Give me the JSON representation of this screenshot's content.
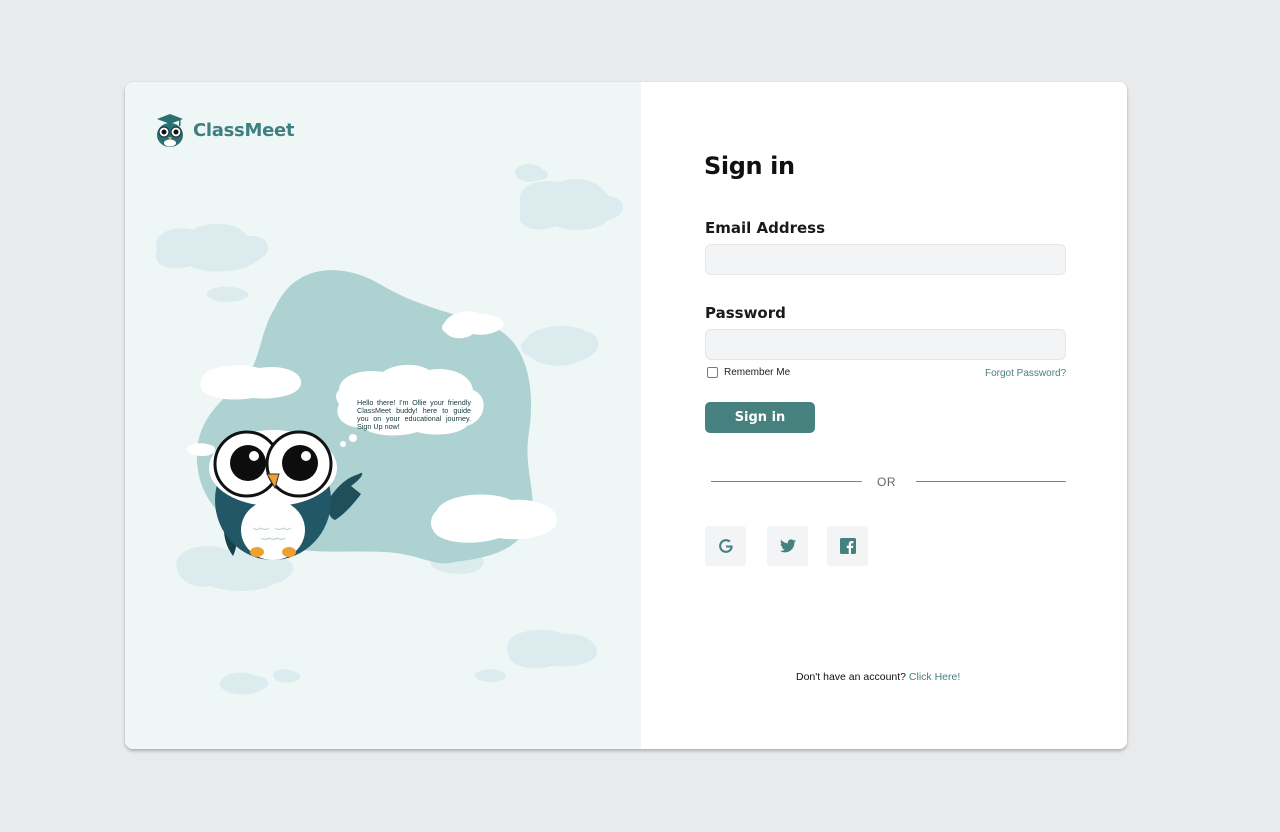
{
  "brand": {
    "name": "ClassMeet"
  },
  "mascot": {
    "speech": "Hello there! I'm Ollie your friendly ClassMeet buddy! here to guide you on your educational journey. Sign Up now!"
  },
  "signin": {
    "title": "Sign in",
    "email_label": "Email Address",
    "email_value": "",
    "password_label": "Password",
    "password_value": "",
    "remember_label": "Remember Me",
    "remember_checked": false,
    "forgot_label": "Forgot Password?",
    "submit_label": "Sign in",
    "divider_label": "OR",
    "social": [
      {
        "name": "google",
        "icon": "google-icon"
      },
      {
        "name": "twitter",
        "icon": "twitter-icon"
      },
      {
        "name": "facebook",
        "icon": "facebook-icon"
      }
    ],
    "signup_prompt": "Don't have an account?",
    "signup_link": "Click Here!"
  },
  "colors": {
    "accent": "#46807f",
    "panel_bg": "#eef6f6",
    "blob": "#aed2d2",
    "page_bg": "#e8eaec"
  }
}
